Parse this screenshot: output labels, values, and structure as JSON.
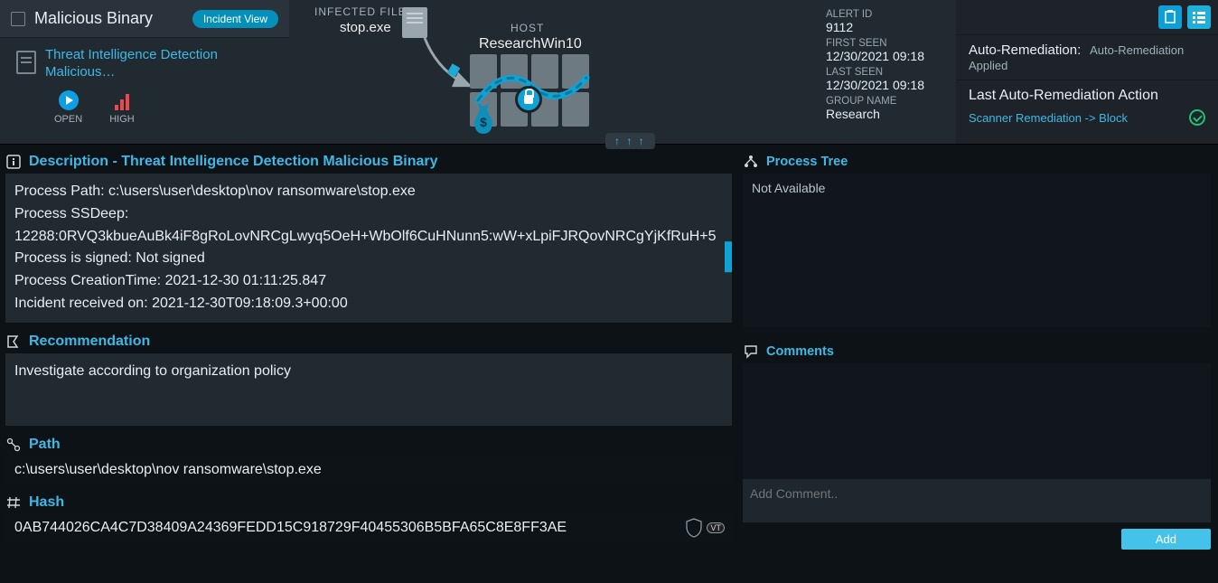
{
  "header": {
    "title": "Malicious Binary",
    "view_pill": "Incident View",
    "subtitle": "Threat Intelligence Detection Malicious…",
    "status_open": "OPEN",
    "severity": "HIGH"
  },
  "center": {
    "infected_file_label": "INFECTED FILE",
    "infected_file": "stop.exe",
    "host_label": "HOST",
    "host_name": "ResearchWin10",
    "arrows": "↑ ↑ ↑"
  },
  "meta": {
    "alert_id_label": "ALERT ID",
    "alert_id": "9112",
    "first_seen_label": "FIRST SEEN",
    "first_seen": "12/30/2021 09:18",
    "last_seen_label": "LAST SEEN",
    "last_seen": "12/30/2021 09:18",
    "group_label": "GROUP NAME",
    "group": "Research"
  },
  "remediation": {
    "title": "Auto-Remediation:",
    "applied": "Auto-Remediation Applied",
    "last_action_label": "Last Auto-Remediation Action",
    "action_link": "Scanner Remediation -> Block"
  },
  "description": {
    "heading": "Description - Threat Intelligence Detection Malicious Binary",
    "lines": {
      "path": "Process Path: c:\\users\\user\\desktop\\nov ransomware\\stop.exe",
      "ssdeep_label": "Process SSDeep:",
      "ssdeep": "12288:0RVQ3kbueAuBk4iF8gRoLovNRCgLwyq5OeH+WbOlf6CuHNunn5:wW+xLpiFJRQovNRCgYjKfRuH+5",
      "signed": "Process is signed: Not signed",
      "creation": "Process CreationTime: 2021-12-30 01:11:25.847",
      "received": "Incident received on: 2021-12-30T09:18:09.3+00:00"
    }
  },
  "recommendation": {
    "heading": "Recommendation",
    "text": "Investigate according to organization policy"
  },
  "path": {
    "heading": "Path",
    "value": "c:\\users\\user\\desktop\\nov ransomware\\stop.exe"
  },
  "hash": {
    "heading": "Hash",
    "value": "0AB744026CA4C7D38409A24369FEDD15C918729F40455306B5BFA65C8E8FF3AE",
    "vt": "VT"
  },
  "process_tree": {
    "heading": "Process Tree",
    "body": "Not Available"
  },
  "comments": {
    "heading": "Comments",
    "placeholder": "Add Comment..",
    "add_btn": "Add"
  }
}
